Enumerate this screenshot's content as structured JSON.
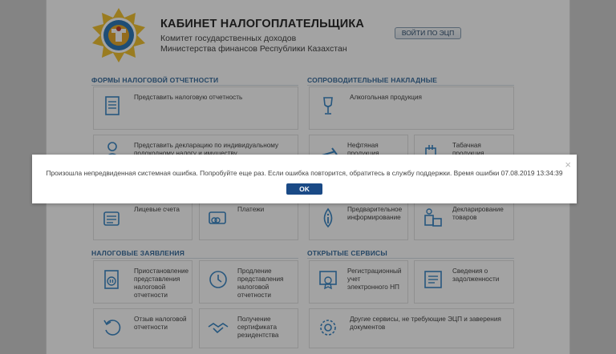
{
  "header": {
    "title": "КАБИНЕТ НАЛОГОПЛАТЕЛЬЩИКА",
    "agency_line1": "Комитет государственных доходов",
    "agency_line2": "Министерства финансов Республики Казахстан",
    "login_button": "ВОЙТИ ПО ЭЦП"
  },
  "sections": {
    "tax_forms": "ФОРМЫ НАЛОГОВОЙ ОТЧЕТНОСТИ",
    "waybills": "СОПРОВОДИТЕЛЬНЫЕ НАКЛАДНЫЕ",
    "tax_applications": "НАЛОГОВЫЕ ЗАЯВЛЕНИЯ",
    "open_services": "ОТКРЫТЫЕ СЕРВИСЫ"
  },
  "cards": {
    "submit_report": "Представить налоговую отчетность",
    "alcohol": "Алкогольная продукция",
    "declaration": "Представить декларацию по индивидуальному подоходному налогу и имуществу",
    "oil": "Нефтяная продукция",
    "tobacco": "Табачная продукция",
    "accounts": "Лицевые счета",
    "payments": "Платежи",
    "preliminary": "Предварительное информирование",
    "goods_decl": "Декларирование товаров",
    "suspend": "Приостановление представления налоговой отчетности",
    "extend": "Продление представления налоговой отчетности",
    "registration": "Регистрационный учет электронного НП",
    "debt_info": "Сведения о задолженности",
    "recall": "Отзыв налоговой отчетности",
    "certificate": "Получение сертификата резидентства",
    "other_services": "Другие сервисы, не требующие ЭЦП и заверения документов"
  },
  "modal": {
    "message": "Произошла непредвиденная системная ошибка. Попробуйте еще раз. Если ошибка повторится, обратитесь в службу поддержки. Время ошибки 07.08.2019 13:34:39",
    "ok": "OK",
    "close": "×"
  },
  "colors": {
    "accent": "#3a6e9e",
    "icon": "#3d88c6",
    "ok_button": "#1a4a86",
    "overlay": "rgba(0,0,0,0.36)"
  },
  "icons": [
    "emblem-logo",
    "document-icon",
    "glass-icon",
    "person-icon",
    "oil-pump-icon",
    "cigarette-icon",
    "calculator-icon",
    "payment-card-icon",
    "info-drop-icon",
    "customs-icon",
    "pause-document-icon",
    "clock-icon",
    "certificate-icon",
    "checklist-icon",
    "undo-icon",
    "handshake-icon",
    "gear-icon"
  ]
}
